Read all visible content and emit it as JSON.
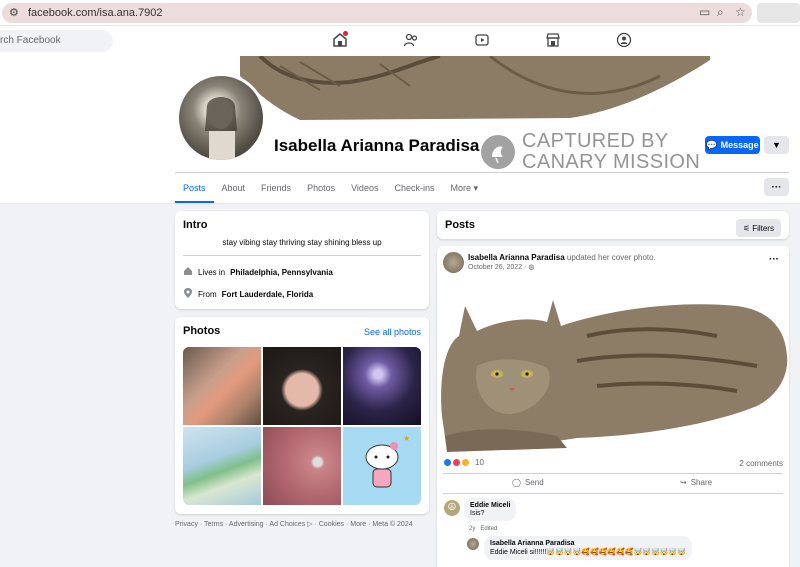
{
  "browser": {
    "url": "facebook.com/isa.ana.7902",
    "icons": [
      "tune-icon",
      "cast-icon",
      "zoom-icon",
      "star-icon"
    ]
  },
  "header": {
    "search_placeholder": "rch Facebook",
    "nav_icons": [
      "home-icon",
      "friends-icon",
      "watch-icon",
      "marketplace-icon",
      "groups-icon"
    ]
  },
  "profile": {
    "name": "Isabella Arianna Paradisa",
    "watermark": {
      "line1": "CAPTURED BY",
      "line2": "CANARY MISSION"
    },
    "message_label": "Message",
    "more_icon": "chevron-down-icon",
    "tabs": [
      {
        "label": "Posts",
        "active": true
      },
      {
        "label": "About"
      },
      {
        "label": "Friends"
      },
      {
        "label": "Photos"
      },
      {
        "label": "Videos"
      },
      {
        "label": "Check-ins"
      },
      {
        "label": "More ▾"
      }
    ],
    "more_dots": "···"
  },
  "intro": {
    "title": "Intro",
    "bio": "stay vibing stay thriving stay shining bless up",
    "lives_in_prefix": "Lives in",
    "lives_in": "Philadelphia, Pennsylvania",
    "from_prefix": "From",
    "from": "Fort Lauderdale, Florida"
  },
  "photos": {
    "title": "Photos",
    "see_all": "See all photos",
    "tiles": [
      "mirror-selfie",
      "selfie",
      "night-lights",
      "weather-map",
      "piercing",
      "hello-kitty"
    ]
  },
  "footer": "Privacy · Terms · Advertising · Ad Choices ▷ · Cookies · More · Meta © 2024",
  "posts": {
    "title": "Posts",
    "filters_label": "Filters",
    "post": {
      "author": "Isabella Arianna Paradisa",
      "action": "updated her cover photo.",
      "date": "October 26, 2022 ·",
      "reactions_count": "10",
      "comments_label": "2 comments",
      "send_label": "Send",
      "share_label": "Share",
      "comments": [
        {
          "author": "Eddie Miceli",
          "text": "Isis?",
          "time": "2y",
          "edited": "Edited"
        },
        {
          "author": "Isabella Arianna Paradisa",
          "text": "Eddie Miceli si!!!!!!🤯🤯🤯🤯🥰🥰🥰🥰🥰🥰🤯🤯🤯🤯🤯🤯"
        }
      ]
    }
  },
  "colors": {
    "accent": "#0866ff",
    "bg": "#f0f2f5"
  }
}
